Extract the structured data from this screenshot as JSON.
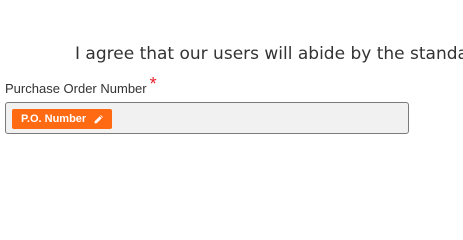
{
  "agreement": {
    "text": "I agree that our users will abide by the standard"
  },
  "purchase_order": {
    "label": "Purchase Order Number",
    "required_mark": "*",
    "tag_label": "P.O. Number",
    "tag_icon": "pencil-icon"
  },
  "colors": {
    "accent": "#ff6a12",
    "required": "#e8202a",
    "field_background": "#f1f1f1",
    "field_border": "#7a7a7a"
  }
}
